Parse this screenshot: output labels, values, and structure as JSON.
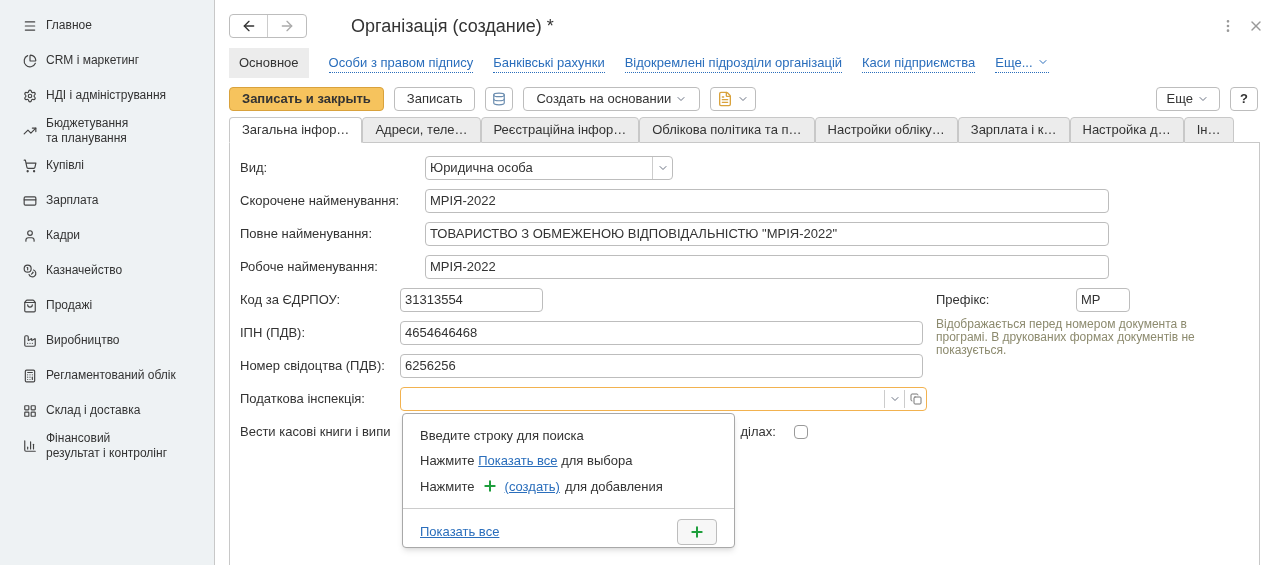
{
  "sidebar": {
    "items": [
      {
        "label": "Главное",
        "selected": false
      },
      {
        "label": "CRM і маркетинг",
        "selected": false
      },
      {
        "label": "НДІ і адміністрування",
        "selected": false
      },
      {
        "label": "Бюджетування\nта планування",
        "selected": false
      },
      {
        "label": "Купівлі",
        "selected": false
      },
      {
        "label": "Зарплата",
        "selected": false
      },
      {
        "label": "Кадри",
        "selected": false
      },
      {
        "label": "Казначейство",
        "selected": false
      },
      {
        "label": "Продажі",
        "selected": false
      },
      {
        "label": "Виробництво",
        "selected": false
      },
      {
        "label": "Регламентований облік",
        "selected": false
      },
      {
        "label": "Склад і доставка",
        "selected": false
      },
      {
        "label": "Фінансовий\nрезультат і контролінг",
        "selected": false
      }
    ]
  },
  "window": {
    "title": "Організація (создание) *"
  },
  "nav_links": [
    {
      "label": "Основное",
      "selected": true
    },
    {
      "label": "Особи з правом підпису",
      "selected": false
    },
    {
      "label": "Банківські рахунки",
      "selected": false
    },
    {
      "label": "Відокремлені підрозділи організацій",
      "selected": false
    },
    {
      "label": "Каси підприємства",
      "selected": false
    }
  ],
  "nav_more": "Еще...",
  "toolbar": {
    "save_close": "Записать и закрыть",
    "save": "Записать",
    "create_based": "Создать на основании",
    "more": "Еще",
    "help": "?"
  },
  "tabs": [
    {
      "label": "Загальна інфор…",
      "selected": true
    },
    {
      "label": "Адреси, теле…",
      "selected": false
    },
    {
      "label": "Реєстраційна інфор…",
      "selected": false
    },
    {
      "label": "Облікова політика та п…",
      "selected": false
    },
    {
      "label": "Настройки обліку…",
      "selected": false
    },
    {
      "label": "Зарплата і к…",
      "selected": false
    },
    {
      "label": "Настройка д…",
      "selected": false
    },
    {
      "label": "Ін…",
      "selected": false
    }
  ],
  "form": {
    "wide_fields": [
      {
        "kind": "select",
        "label": "Вид:",
        "value": "Юридична особа"
      },
      {
        "kind": "text",
        "label": "Скорочене найменування:",
        "value": "МРІЯ-2022"
      },
      {
        "kind": "text",
        "label": "Повне найменування:",
        "value": "ТОВАРИСТВО З ОБМЕЖЕНОЮ ВІДПОВІДАЛЬНІСТЮ \"МРІЯ-2022\""
      },
      {
        "kind": "text",
        "label": "Робоче найменування:",
        "value": "МРІЯ-2022"
      }
    ],
    "code_fields": [
      {
        "kind": "short",
        "label": "Код за ЄДРПОУ:",
        "value": "31313554"
      },
      {
        "kind": "text",
        "label": "ІПН (ПДВ):",
        "value": "4654646468"
      },
      {
        "kind": "text",
        "label": "Номер свідоцтва (ПДВ):",
        "value": "6256256"
      }
    ],
    "tax_office": {
      "label": "Податкова інспекція:",
      "focused": true
    },
    "cash_books": {
      "label_start": "Вести касові книги і випи",
      "label_end": "ділах:",
      "checked": false
    },
    "prefix": {
      "label": "Префікс:",
      "value": "МР",
      "hint": "Відображається перед номером документа в програмі. В друкованих формах документів не показується."
    }
  },
  "popup": {
    "search_hint": "Введите строку для поиска",
    "show_all_line": {
      "before": "Нажмите",
      "link": "Показать все",
      "after": "для выбора"
    },
    "create_line": {
      "before": "Нажмите",
      "link": "(создать)",
      "after": "для добавления"
    },
    "footer_link": "Показать все"
  }
}
